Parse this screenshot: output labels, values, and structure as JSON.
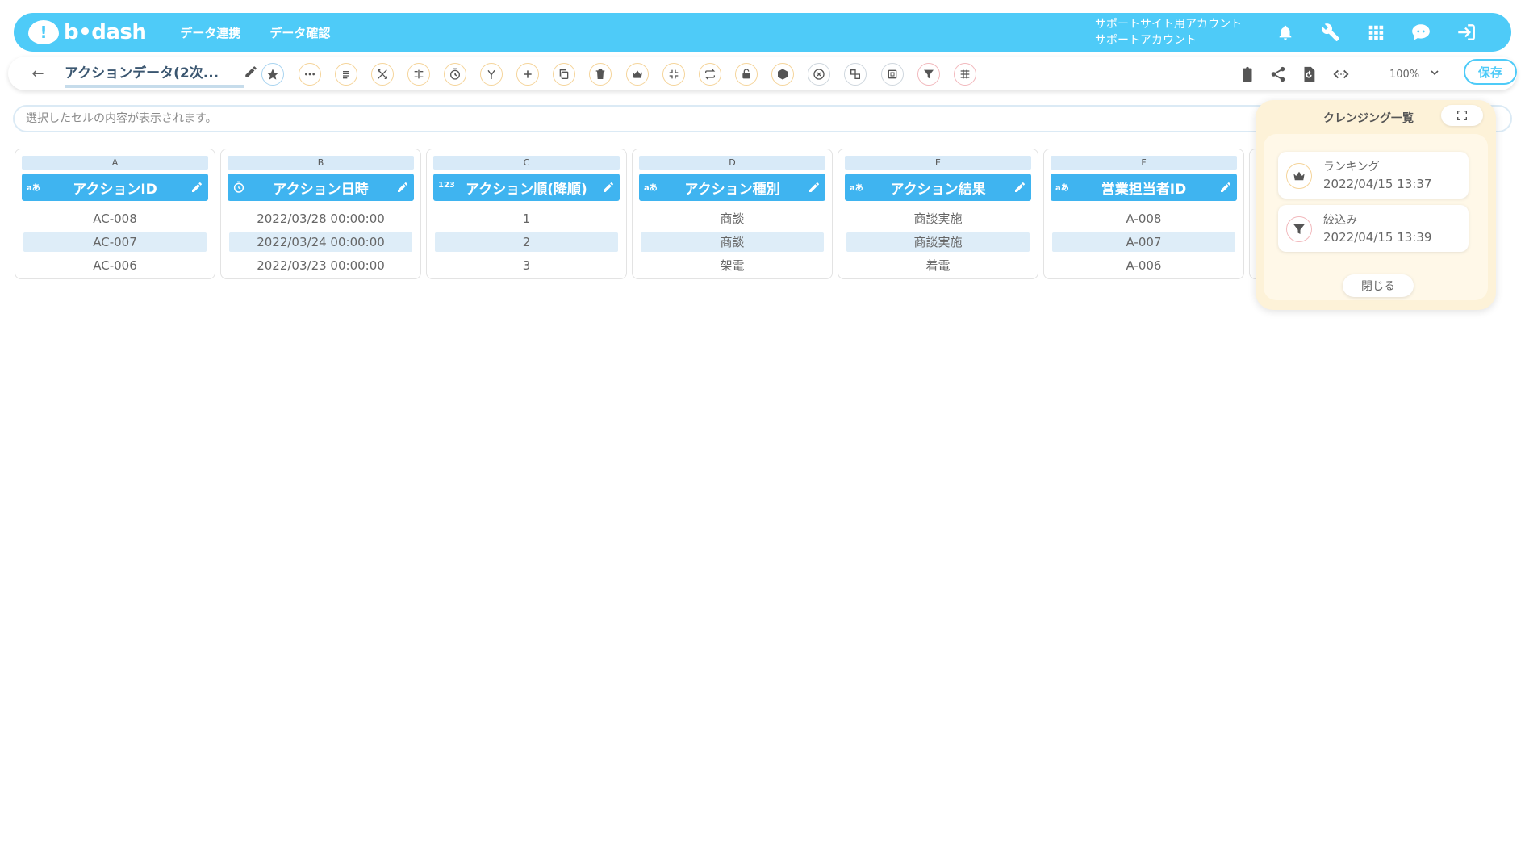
{
  "header": {
    "logo_text": "b•dash",
    "nav": [
      "データ連携",
      "データ確認"
    ],
    "account_line1": "サポートサイト用アカウント",
    "account_line2": "サポートアカウント"
  },
  "toolbar": {
    "title": "アクションデータ(2次...",
    "zoom": "100%",
    "save_label": "保存"
  },
  "cellbar": {
    "placeholder": "選択したセルの内容が表示されます。"
  },
  "columns": [
    {
      "letter": "A",
      "type_icon": "aあ",
      "name": "アクションID",
      "cells": [
        "AC-008",
        "AC-007",
        "AC-006"
      ]
    },
    {
      "letter": "B",
      "type_icon": "clock",
      "name": "アクション日時",
      "cells": [
        "2022/03/28 00:00:00",
        "2022/03/24 00:00:00",
        "2022/03/23 00:00:00"
      ]
    },
    {
      "letter": "C",
      "type_icon": "123",
      "name": "アクション順(降順)",
      "cells": [
        "1",
        "2",
        "3"
      ]
    },
    {
      "letter": "D",
      "type_icon": "aあ",
      "name": "アクション種別",
      "cells": [
        "商談",
        "商談",
        "架電"
      ]
    },
    {
      "letter": "E",
      "type_icon": "aあ",
      "name": "アクション結果",
      "cells": [
        "商談実施",
        "商談実施",
        "着電"
      ]
    },
    {
      "letter": "F",
      "type_icon": "aあ",
      "name": "営業担当者ID",
      "cells": [
        "A-008",
        "A-007",
        "A-006"
      ]
    }
  ],
  "panel": {
    "title": "クレンジング一覧",
    "items": [
      {
        "name": "ランキング",
        "date": "2022/04/15 13:37",
        "icon": "crown-icon"
      },
      {
        "name": "絞込み",
        "date": "2022/04/15 13:39",
        "icon": "filter-icon"
      }
    ],
    "close_label": "閉じる"
  },
  "colors": {
    "header": "#4ecbf8",
    "column_header": "#3fb4f0",
    "panel": "#fdf2d8"
  }
}
